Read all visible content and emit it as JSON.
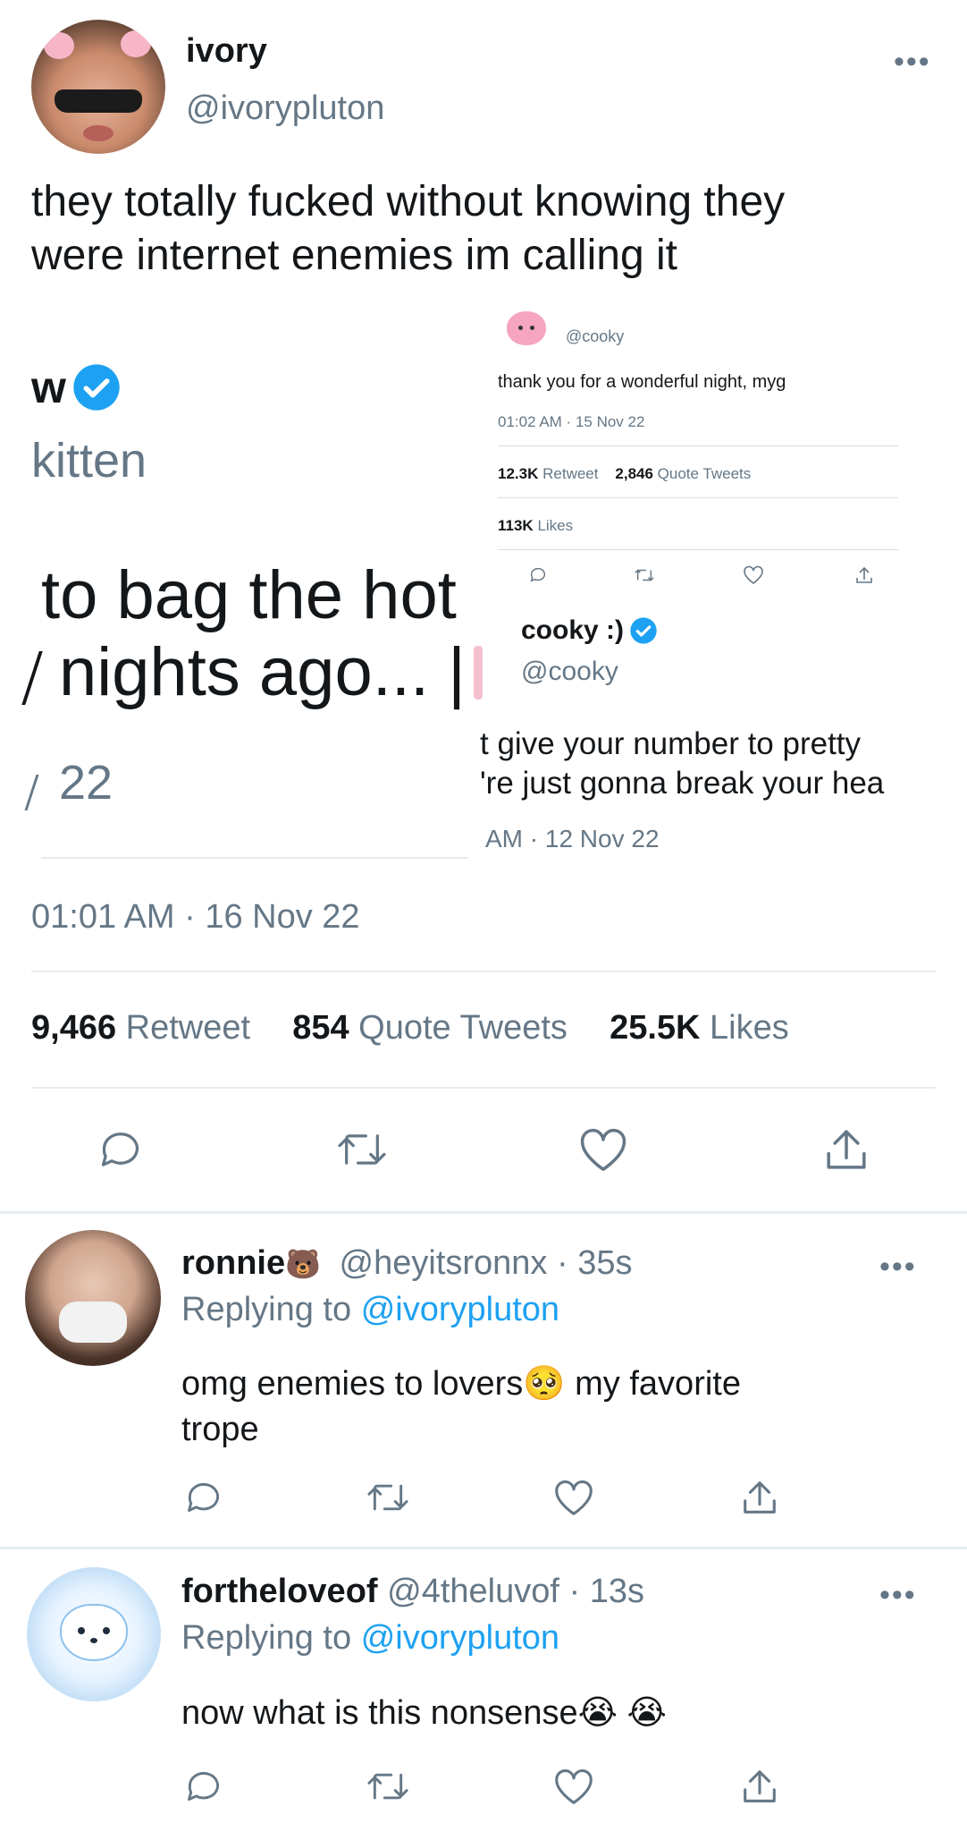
{
  "tweet": {
    "display_name": "ivory",
    "handle": "@ivorypluton",
    "text_line1": "they totally fucked without knowing they",
    "text_line2": "were internet enemies im calling it",
    "timestamp": "01:01 AM · 16 Nov 22",
    "retweets_count": "9,466",
    "retweets_label": "Retweet",
    "quotes_count": "854",
    "quotes_label": "Quote Tweets",
    "likes_count": "25.5K",
    "likes_label": "Likes"
  },
  "left_screenshot": {
    "name_fragment": "w",
    "handle_fragment": "kitten",
    "text_line1": "to bag the hot",
    "text_line2": "nights ago... |",
    "date_fragment": "22"
  },
  "top_right_screenshot": {
    "handle": "@cooky",
    "text": "thank you for a wonderful night, myg",
    "timestamp": "01:02 AM · 15 Nov 22",
    "retweets_count": "12.3K",
    "retweets_label": "Retweet",
    "quotes_count": "2,846",
    "quotes_label": "Quote Tweets",
    "likes_count": "113K",
    "likes_label": "Likes"
  },
  "bottom_right_screenshot": {
    "display_name": "cooky :)",
    "handle": "@cooky",
    "text_line1": "t give your number to pretty",
    "text_line2": "'re just gonna break your hea",
    "timestamp": "AM · 12 Nov 22"
  },
  "replies": [
    {
      "display_name": "ronnie",
      "emoji": "🐻",
      "handle": "@heyitsronnx",
      "time": "· 35s",
      "replying_label": "Replying to",
      "replying_to": "@ivorypluton",
      "text_line1": "omg enemies to lovers🥺  my favorite",
      "text_line2": "trope"
    },
    {
      "display_name": "fortheloveof",
      "handle": "@4theluvof",
      "time": "· 13s",
      "replying_label": "Replying to",
      "replying_to": "@ivorypluton",
      "text_line1": "now what is this nonsense😭 😭"
    }
  ],
  "icons": {
    "reply": "speech-bubble-icon",
    "retweet": "retweet-arrows-icon",
    "like": "heart-icon",
    "share": "share-upload-icon",
    "more": "more-dots-icon",
    "verified": "verified-badge-icon"
  },
  "colors": {
    "text": "#14171a",
    "secondary": "#657786",
    "accent": "#1da1f2",
    "divider": "#e6ecf0"
  }
}
